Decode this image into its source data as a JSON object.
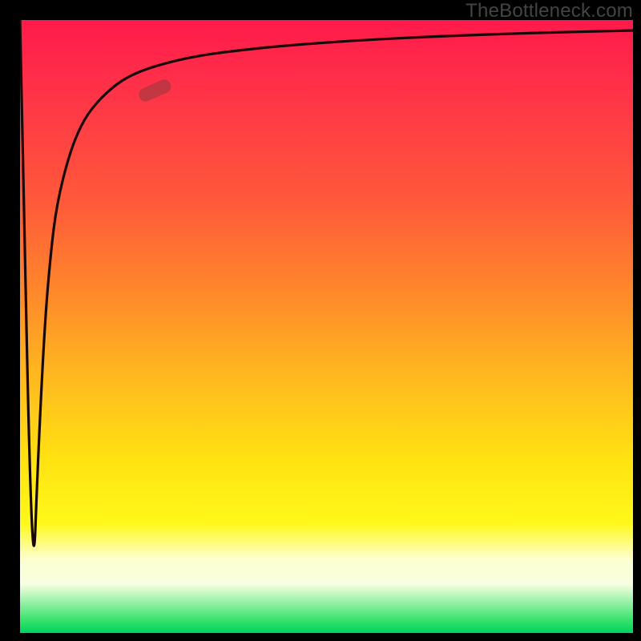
{
  "watermark": "TheBottleneck.com",
  "chart_data": {
    "type": "line",
    "title": "",
    "xlabel": "",
    "ylabel": "",
    "xlim": [
      0,
      100
    ],
    "ylim": [
      0,
      100
    ],
    "series": [
      {
        "name": "bottleneck-curve",
        "x": [
          0,
          2,
          3,
          4,
          5,
          6,
          8,
          10,
          12,
          15,
          18,
          22,
          28,
          35,
          45,
          60,
          80,
          100
        ],
        "values": [
          100,
          4,
          30,
          50,
          62,
          70,
          78,
          83,
          86,
          89,
          91,
          92.5,
          94,
          95,
          96,
          97,
          97.8,
          98.3
        ]
      }
    ],
    "marker": {
      "x": 22,
      "y": 88.5
    },
    "background_gradient": {
      "top": "#ff1a4b",
      "mid": "#ffe312",
      "bottom": "#00d060"
    }
  }
}
